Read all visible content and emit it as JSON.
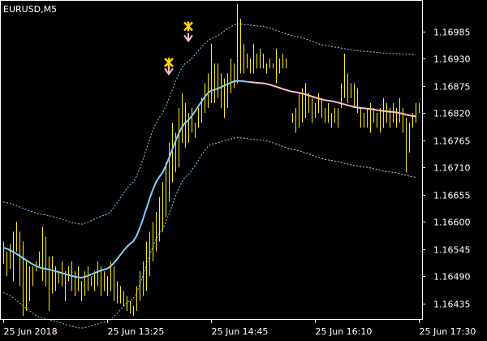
{
  "chart_data": {
    "type": "line",
    "symbol_label": "EURUSD,M5",
    "y_ticks": [
      "1.16985",
      "1.16930",
      "1.16875",
      "1.16820",
      "1.16765",
      "1.16710",
      "1.16655",
      "1.16600",
      "1.16545",
      "1.16490",
      "1.16435"
    ],
    "x_ticks": [
      "25 Jun 2018",
      "25 Jun 13:25",
      "25 Jun 14:45",
      "25 Jun 16:10",
      "25 Jun 17:30"
    ],
    "x_tick_pos": [
      0,
      32,
      64,
      96,
      128
    ],
    "ylim": [
      1.16405,
      1.17045
    ],
    "x_count": 129,
    "grid": false,
    "colors": {
      "background": "#000000",
      "axis": "#ffffff",
      "bars": "#ffee00",
      "middle_up": "#87cefa",
      "middle_down": "#ffc0cb",
      "upper_band_up": "#87cefa",
      "upper_band_down": "#b0c4de",
      "lower_band_up": "#87cefa",
      "lower_band_down": "#ffc0cb",
      "arrow": "#ffc0cb",
      "star": "#ffd700"
    },
    "middle_line": [
      [
        0,
        1.16548
      ],
      [
        12,
        1.16506
      ],
      [
        24,
        1.16487
      ],
      [
        32,
        1.16505
      ],
      [
        40,
        1.1656
      ],
      [
        48,
        1.1669
      ],
      [
        56,
        1.168
      ],
      [
        64,
        1.16865
      ],
      [
        72,
        1.16885
      ],
      [
        80,
        1.1688
      ],
      [
        90,
        1.16862
      ],
      [
        100,
        1.16845
      ],
      [
        110,
        1.1683
      ],
      [
        120,
        1.16822
      ],
      [
        127,
        1.16813
      ]
    ],
    "middle_split_x": 76,
    "upper_band": [
      [
        0,
        1.1664
      ],
      [
        12,
        1.16615
      ],
      [
        24,
        1.16595
      ],
      [
        32,
        1.16615
      ],
      [
        40,
        1.1668
      ],
      [
        48,
        1.1681
      ],
      [
        56,
        1.1692
      ],
      [
        64,
        1.1697
      ],
      [
        72,
        1.17
      ],
      [
        80,
        1.16995
      ],
      [
        90,
        1.16975
      ],
      [
        100,
        1.16955
      ],
      [
        110,
        1.16945
      ],
      [
        120,
        1.1694
      ],
      [
        127,
        1.16938
      ]
    ],
    "upper_split_x": 76,
    "lower_band": [
      [
        0,
        1.16457
      ],
      [
        12,
        1.16405
      ],
      [
        24,
        1.16385
      ],
      [
        32,
        1.16398
      ],
      [
        40,
        1.16445
      ],
      [
        48,
        1.16575
      ],
      [
        56,
        1.1669
      ],
      [
        64,
        1.16757
      ],
      [
        72,
        1.1677
      ],
      [
        80,
        1.16765
      ],
      [
        90,
        1.16745
      ],
      [
        100,
        1.16725
      ],
      [
        110,
        1.16712
      ],
      [
        120,
        1.167
      ],
      [
        127,
        1.1669
      ]
    ],
    "lower_split_x": 70,
    "bars": [
      [
        0,
        1.1656,
        1.16515
      ],
      [
        1,
        1.1654,
        1.1649
      ],
      [
        2,
        1.16555,
        1.16505
      ],
      [
        3,
        1.1658,
        1.1648
      ],
      [
        4,
        1.166,
        1.1654
      ],
      [
        5,
        1.1658,
        1.1647
      ],
      [
        6,
        1.1656,
        1.1641
      ],
      [
        7,
        1.1652,
        1.1642
      ],
      [
        8,
        1.1651,
        1.1644
      ],
      [
        9,
        1.1651,
        1.1647
      ],
      [
        10,
        1.1652,
        1.165
      ],
      [
        11,
        1.1654,
        1.1651
      ],
      [
        12,
        1.1659,
        1.1648
      ],
      [
        13,
        1.1657,
        1.1647
      ],
      [
        14,
        1.1653,
        1.1642
      ],
      [
        15,
        1.1653,
        1.16455
      ],
      [
        16,
        1.1651,
        1.1646
      ],
      [
        17,
        1.165,
        1.16475
      ],
      [
        18,
        1.1652,
        1.1647
      ],
      [
        19,
        1.165,
        1.1644
      ],
      [
        20,
        1.1651,
        1.1648
      ],
      [
        21,
        1.1652,
        1.1646
      ],
      [
        22,
        1.165,
        1.1645
      ],
      [
        23,
        1.1651,
        1.1646
      ],
      [
        24,
        1.1648,
        1.1644
      ],
      [
        25,
        1.165,
        1.1645
      ],
      [
        26,
        1.1651,
        1.1646
      ],
      [
        27,
        1.1649,
        1.1647
      ],
      [
        28,
        1.165,
        1.1646
      ],
      [
        29,
        1.1652,
        1.1647
      ],
      [
        30,
        1.1651,
        1.1645
      ],
      [
        31,
        1.165,
        1.1646
      ],
      [
        32,
        1.1649,
        1.1645
      ],
      [
        33,
        1.1652,
        1.1646
      ],
      [
        34,
        1.1651,
        1.1644
      ],
      [
        35,
        1.1648,
        1.16435
      ],
      [
        36,
        1.1647,
        1.16435
      ],
      [
        37,
        1.1646,
        1.1643
      ],
      [
        38,
        1.1645,
        1.1642
      ],
      [
        39,
        1.1644,
        1.16415
      ],
      [
        40,
        1.1643,
        1.1641
      ],
      [
        41,
        1.1647,
        1.1642
      ],
      [
        42,
        1.165,
        1.1644
      ],
      [
        43,
        1.1652,
        1.1645
      ],
      [
        44,
        1.1656,
        1.1646
      ],
      [
        45,
        1.1658,
        1.1649
      ],
      [
        46,
        1.166,
        1.1652
      ],
      [
        47,
        1.1662,
        1.1654
      ],
      [
        48,
        1.1665,
        1.1656
      ],
      [
        49,
        1.1668,
        1.1658
      ],
      [
        50,
        1.1672,
        1.1661
      ],
      [
        51,
        1.1676,
        1.1664
      ],
      [
        52,
        1.168,
        1.1668
      ],
      [
        53,
        1.1678,
        1.167
      ],
      [
        54,
        1.1683,
        1.1671
      ],
      [
        55,
        1.1686,
        1.1676
      ],
      [
        56,
        1.1684,
        1.1675
      ],
      [
        57,
        1.1682,
        1.1676
      ],
      [
        58,
        1.1683,
        1.1678
      ],
      [
        59,
        1.168,
        1.1677
      ],
      [
        60,
        1.1683,
        1.1679
      ],
      [
        61,
        1.1685,
        1.168
      ],
      [
        62,
        1.1688,
        1.1682
      ],
      [
        63,
        1.169,
        1.1683
      ],
      [
        64,
        1.1696,
        1.1684
      ],
      [
        65,
        1.1692,
        1.1684
      ],
      [
        66,
        1.1692,
        1.1685
      ],
      [
        67,
        1.169,
        1.1683
      ],
      [
        68,
        1.1689,
        1.1681
      ],
      [
        69,
        1.169,
        1.1683
      ],
      [
        70,
        1.1693,
        1.1686
      ],
      [
        71,
        1.1692,
        1.1687
      ],
      [
        72,
        1.1704,
        1.1688
      ],
      [
        73,
        1.1701,
        1.169
      ],
      [
        74,
        1.1696,
        1.169
      ],
      [
        75,
        1.1694,
        1.1691
      ],
      [
        76,
        1.1693,
        1.169
      ],
      [
        77,
        1.1696,
        1.169
      ],
      [
        78,
        1.1694,
        1.1691
      ],
      [
        79,
        1.1695,
        1.1691
      ],
      [
        80,
        1.1694,
        1.1691
      ],
      [
        81,
        1.1692,
        1.169
      ],
      [
        82,
        1.1693,
        1.1691
      ],
      [
        83,
        1.1692,
        1.1691
      ],
      [
        84,
        1.1695,
        1.1688
      ],
      [
        85,
        1.1693,
        1.169
      ],
      [
        86,
        1.1694,
        1.1691
      ],
      [
        87,
        1.1693,
        1.1691
      ],
      [
        89,
        1.1682,
        1.168
      ],
      [
        90,
        1.1683,
        1.1678
      ],
      [
        91,
        1.1686,
        1.1679
      ],
      [
        92,
        1.1687,
        1.168
      ],
      [
        93,
        1.1688,
        1.1681
      ],
      [
        94,
        1.1686,
        1.1682
      ],
      [
        95,
        1.1685,
        1.168
      ],
      [
        96,
        1.1684,
        1.1681
      ],
      [
        97,
        1.1686,
        1.1682
      ],
      [
        98,
        1.1685,
        1.1681
      ],
      [
        99,
        1.1683,
        1.168
      ],
      [
        100,
        1.1684,
        1.168
      ],
      [
        101,
        1.1682,
        1.1679
      ],
      [
        102,
        1.1683,
        1.168
      ],
      [
        103,
        1.1683,
        1.1679
      ],
      [
        104,
        1.1688,
        1.1683
      ],
      [
        105,
        1.1694,
        1.1685
      ],
      [
        106,
        1.169,
        1.1684
      ],
      [
        107,
        1.1688,
        1.1685
      ],
      [
        108,
        1.1688,
        1.1683
      ],
      [
        109,
        1.1687,
        1.1682
      ],
      [
        110,
        1.1683,
        1.1679
      ],
      [
        111,
        1.1682,
        1.1679
      ],
      [
        112,
        1.1683,
        1.1679
      ],
      [
        113,
        1.1684,
        1.1678
      ],
      [
        114,
        1.1683,
        1.168
      ],
      [
        115,
        1.1682,
        1.1679
      ],
      [
        116,
        1.1683,
        1.1678
      ],
      [
        117,
        1.1685,
        1.1679
      ],
      [
        118,
        1.1684,
        1.168
      ],
      [
        119,
        1.1683,
        1.1679
      ],
      [
        120,
        1.1684,
        1.168
      ],
      [
        121,
        1.1683,
        1.1679
      ],
      [
        122,
        1.1685,
        1.168
      ],
      [
        123,
        1.1683,
        1.1678
      ],
      [
        124,
        1.1681,
        1.167
      ],
      [
        125,
        1.168,
        1.1674
      ],
      [
        126,
        1.1682,
        1.1679
      ],
      [
        127,
        1.1684,
        1.168
      ],
      [
        128,
        1.1684,
        1.1682
      ]
    ],
    "arrows": [
      [
        51,
        1.16905
      ],
      [
        57,
        1.16972
      ]
    ],
    "stars": [
      [
        51,
        1.16922
      ],
      [
        57,
        1.16995
      ]
    ]
  }
}
